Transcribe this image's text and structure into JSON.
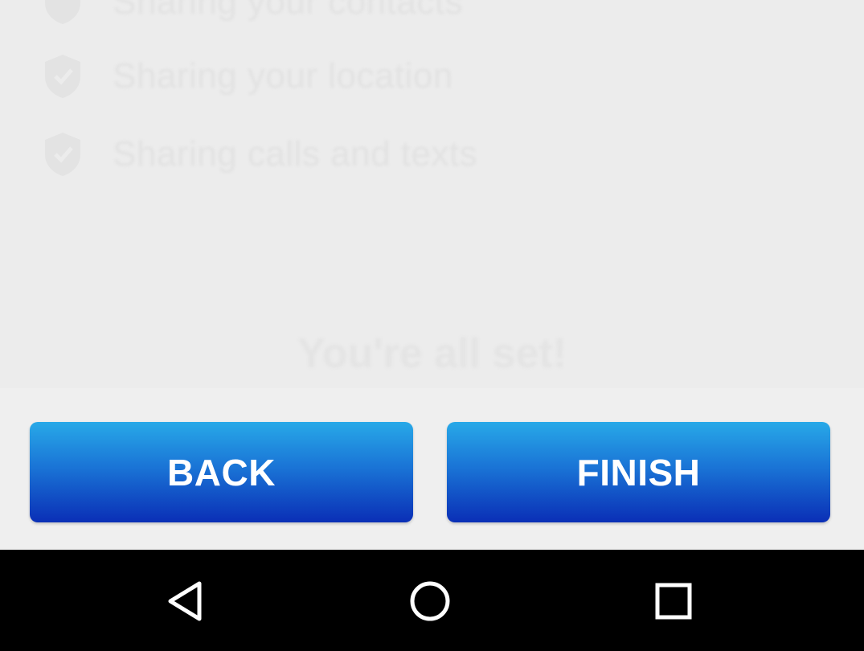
{
  "permissions": {
    "items": [
      {
        "label": "Sharing your location",
        "icon": "shield-icon"
      },
      {
        "label": "Sharing calls and texts",
        "icon": "shield-icon"
      }
    ],
    "top_partial_label": "Sharing your contacts"
  },
  "ready_text": "You're all set!",
  "buttons": {
    "back_label": "BACK",
    "finish_label": "FINISH"
  },
  "nav_bar": {
    "back_icon": "back-triangle-icon",
    "home_icon": "home-circle-icon",
    "recents_icon": "recents-square-icon"
  },
  "colors": {
    "button_top": "#28a9e8",
    "button_bottom": "#0a2fb6",
    "background": "#ededed",
    "nav_bar": "#000000"
  }
}
